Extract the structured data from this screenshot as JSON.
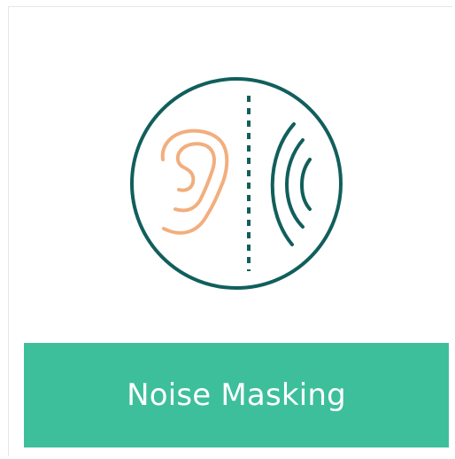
{
  "card": {
    "title": "Noise Masking",
    "icon": "ear-sound-wave-icon"
  },
  "colors": {
    "accent": "#3dbf9c",
    "circle_stroke": "#115f5c",
    "ear_stroke": "#f2ae7e",
    "label_text": "#ffffff"
  }
}
